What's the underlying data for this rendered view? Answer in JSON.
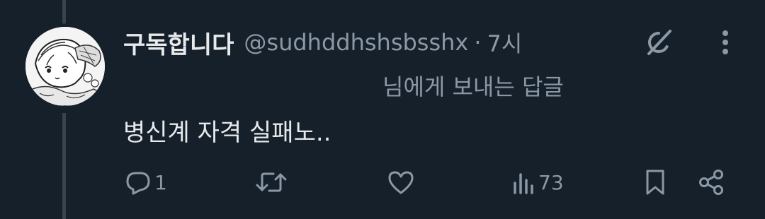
{
  "tweet": {
    "display_name": "구독합니다",
    "handle": "@sudhddhshsbsshx",
    "separator": "·",
    "time": "7시",
    "reply_to": "님에게 보내는 답글",
    "text": "병신계 자격 실패노.."
  },
  "actions": {
    "reply_count": "1",
    "retweet_count": "",
    "like_count": "",
    "views_count": "73"
  },
  "icons": {
    "avatar": "manga-girl-avatar",
    "grok": "grok-icon",
    "more": "more-vertical-icon",
    "reply": "reply-icon",
    "retweet": "retweet-icon",
    "like": "heart-icon",
    "views": "views-icon",
    "bookmark": "bookmark-icon",
    "share": "share-icon"
  },
  "colors": {
    "background": "#15202b",
    "text_primary": "#e7e9ea",
    "text_secondary": "#8b98a5",
    "thread_line": "#38444d"
  }
}
